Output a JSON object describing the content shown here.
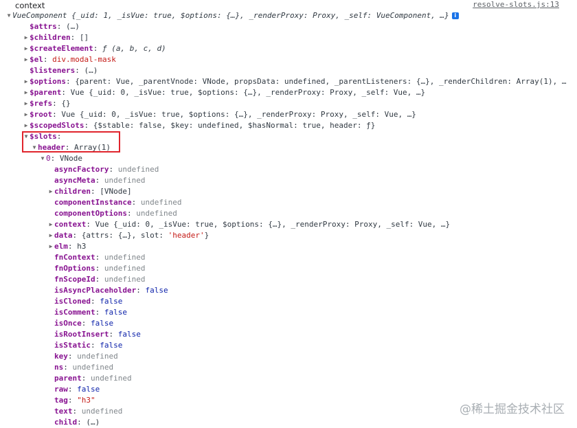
{
  "header": {
    "label": "context",
    "source": "resolve-slots.js:13"
  },
  "rows": [
    {
      "indent": 0,
      "toggle": "open",
      "name": "",
      "value": "VueComponent {_uid: 1, _isVue: true, $options: {…}, _renderProxy: Proxy, _self: VueComponent, …}",
      "vclass": "v ital",
      "info": true
    },
    {
      "indent": 1,
      "toggle": "none",
      "name": "$attrs",
      "sep": ": ",
      "value": " (…)",
      "vclass": "v"
    },
    {
      "indent": 1,
      "toggle": "closed",
      "name": "$children",
      "sep": ": ",
      "value": "[]",
      "vclass": "v"
    },
    {
      "indent": 1,
      "toggle": "closed",
      "name": "$createElement",
      "sep": ": ",
      "value": "ƒ (a, b, c, d)",
      "vclass": "v ital"
    },
    {
      "indent": 1,
      "toggle": "closed",
      "name": "$el",
      "sep": ": ",
      "value": "div.modal-mask",
      "vclass": "str"
    },
    {
      "indent": 1,
      "toggle": "none",
      "name": "$listeners",
      "sep": ": ",
      "value": "(…)",
      "vclass": "v"
    },
    {
      "indent": 1,
      "toggle": "closed",
      "name": "$options",
      "sep": ": ",
      "value": "{parent: Vue, _parentVnode: VNode, propsData: undefined, _parentListeners: {…}, _renderChildren: Array(1), …",
      "vclass": "v"
    },
    {
      "indent": 1,
      "toggle": "closed",
      "name": "$parent",
      "sep": ": ",
      "value": "Vue {_uid: 0, _isVue: true, $options: {…}, _renderProxy: Proxy, _self: Vue, …}",
      "vclass": "v"
    },
    {
      "indent": 1,
      "toggle": "closed",
      "name": "$refs",
      "sep": ": ",
      "value": "{}",
      "vclass": "v"
    },
    {
      "indent": 1,
      "toggle": "closed",
      "name": "$root",
      "sep": ": ",
      "value": "Vue {_uid: 0, _isVue: true, $options: {…}, _renderProxy: Proxy, _self: Vue, …}",
      "vclass": "v"
    },
    {
      "indent": 1,
      "toggle": "closed",
      "name": "$scopedSlots",
      "sep": ": ",
      "value": "{$stable: false, $key: undefined, $hasNormal: true, header: ƒ}",
      "vclass": "v"
    },
    {
      "indent": 1,
      "toggle": "open",
      "name": "$slots",
      "sep": ":",
      "value": "",
      "vclass": "v"
    },
    {
      "indent": 2,
      "toggle": "open",
      "name": "header",
      "sep": ": ",
      "value": "Array(1)",
      "vclass": "v"
    },
    {
      "indent": 3,
      "toggle": "open",
      "name": "0",
      "sep": ": ",
      "value": "VNode",
      "vclass": "v"
    },
    {
      "indent": 4,
      "toggle": "none",
      "name": "asyncFactory",
      "sep": ": ",
      "value": "undefined",
      "vclass": "und"
    },
    {
      "indent": 4,
      "toggle": "none",
      "name": "asyncMeta",
      "sep": ": ",
      "value": "undefined",
      "vclass": "und"
    },
    {
      "indent": 4,
      "toggle": "closed",
      "name": "children",
      "sep": ": ",
      "value": "[VNode]",
      "vclass": "v"
    },
    {
      "indent": 4,
      "toggle": "none",
      "name": "componentInstance",
      "sep": ": ",
      "value": "undefined",
      "vclass": "und"
    },
    {
      "indent": 4,
      "toggle": "none",
      "name": "componentOptions",
      "sep": ": ",
      "value": "undefined",
      "vclass": "und"
    },
    {
      "indent": 4,
      "toggle": "closed",
      "name": "context",
      "sep": ": ",
      "value": "Vue {_uid: 0, _isVue: true, $options: {…}, _renderProxy: Proxy, _self: Vue, …}",
      "vclass": "v"
    },
    {
      "indent": 4,
      "toggle": "closed",
      "name": "data",
      "sep": ": ",
      "value": "{attrs: {…}, slot: 'header'}",
      "vclass": "v",
      "slotHeader": true
    },
    {
      "indent": 4,
      "toggle": "closed",
      "name": "elm",
      "sep": ": ",
      "value": "h3",
      "vclass": "v"
    },
    {
      "indent": 4,
      "toggle": "none",
      "name": "fnContext",
      "sep": ": ",
      "value": "undefined",
      "vclass": "und"
    },
    {
      "indent": 4,
      "toggle": "none",
      "name": "fnOptions",
      "sep": ": ",
      "value": "undefined",
      "vclass": "und"
    },
    {
      "indent": 4,
      "toggle": "none",
      "name": "fnScopeId",
      "sep": ": ",
      "value": "undefined",
      "vclass": "und"
    },
    {
      "indent": 4,
      "toggle": "none",
      "name": "isAsyncPlaceholder",
      "sep": ": ",
      "value": "false",
      "vclass": "bool"
    },
    {
      "indent": 4,
      "toggle": "none",
      "name": "isCloned",
      "sep": ": ",
      "value": "false",
      "vclass": "bool"
    },
    {
      "indent": 4,
      "toggle": "none",
      "name": "isComment",
      "sep": ": ",
      "value": "false",
      "vclass": "bool"
    },
    {
      "indent": 4,
      "toggle": "none",
      "name": "isOnce",
      "sep": ": ",
      "value": "false",
      "vclass": "bool"
    },
    {
      "indent": 4,
      "toggle": "none",
      "name": "isRootInsert",
      "sep": ": ",
      "value": "false",
      "vclass": "bool"
    },
    {
      "indent": 4,
      "toggle": "none",
      "name": "isStatic",
      "sep": ": ",
      "value": "false",
      "vclass": "bool"
    },
    {
      "indent": 4,
      "toggle": "none",
      "name": "key",
      "sep": ": ",
      "value": "undefined",
      "vclass": "und"
    },
    {
      "indent": 4,
      "toggle": "none",
      "name": "ns",
      "sep": ": ",
      "value": "undefined",
      "vclass": "und"
    },
    {
      "indent": 4,
      "toggle": "none",
      "name": "parent",
      "sep": ": ",
      "value": "undefined",
      "vclass": "und"
    },
    {
      "indent": 4,
      "toggle": "none",
      "name": "raw",
      "sep": ": ",
      "value": "false",
      "vclass": "bool"
    },
    {
      "indent": 4,
      "toggle": "none",
      "name": "tag",
      "sep": ": ",
      "value": "\"h3\"",
      "vclass": "str"
    },
    {
      "indent": 4,
      "toggle": "none",
      "name": "text",
      "sep": ": ",
      "value": "undefined",
      "vclass": "und"
    },
    {
      "indent": 4,
      "toggle": "none",
      "name": "child",
      "sep": ": ",
      "value": " (…)",
      "vclass": "v"
    }
  ],
  "watermark": "@稀土掘金技术社区"
}
